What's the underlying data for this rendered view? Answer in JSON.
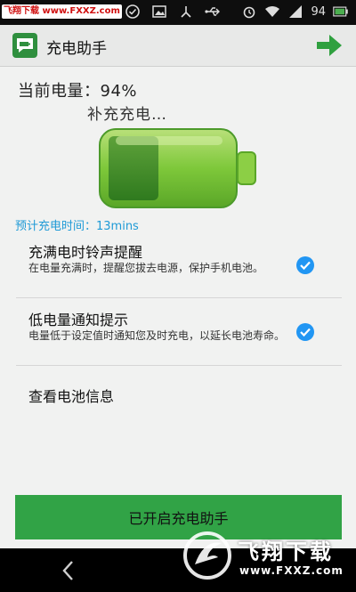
{
  "status_bar": {
    "badge_site": "飞翔下载",
    "badge_url": "www.FXXZ.com",
    "battery_number": "94",
    "icons": [
      "check-circle-icon",
      "image-icon",
      "usb-debug-icon",
      "usb-icon",
      "alarm-icon",
      "wifi-icon",
      "signal-icon",
      "battery-icon"
    ]
  },
  "app": {
    "title": "充电助手",
    "logo_icon": "battery-chat-icon",
    "forward_icon": "arrow-right-icon"
  },
  "battery": {
    "status_line": "当前电量：94%",
    "charging_text": "补充充电…",
    "level_percent": 94,
    "estimate": "预计充电时间：13mins"
  },
  "settings": [
    {
      "title": "充满电时铃声提醒",
      "description": "在电量充满时，提醒您拔去电源，保护手机电池。",
      "checked": true
    },
    {
      "title": "低电量通知提示",
      "description": "电量低于设定值时通知您及时充电，以延长电池寿命。",
      "checked": true
    }
  ],
  "battery_info_label": "查看电池信息",
  "enable_button_label": "已开启充电助手",
  "nav": {
    "back_icon": "back-chevron-icon"
  },
  "watermark": {
    "text": "飞翔下载",
    "url": "www.FXXZ.com"
  },
  "colors": {
    "accent_green": "#31a346",
    "check_blue": "#2196f3",
    "estimate_blue": "#1e9ad6",
    "battery_green": "#7ec83a"
  }
}
